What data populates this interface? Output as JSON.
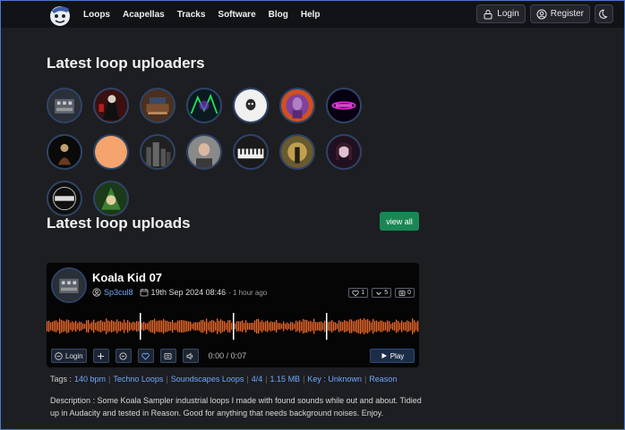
{
  "nav": {
    "links": [
      "Loops",
      "Acapellas",
      "Tracks",
      "Software",
      "Blog",
      "Help"
    ],
    "login": "Login",
    "register": "Register"
  },
  "sections": {
    "uploaders_title": "Latest loop uploaders",
    "uploads_title": "Latest loop uploads",
    "view_all": "view all"
  },
  "uploaders": [
    {
      "icon": "synth-avatar"
    },
    {
      "icon": "red-figure-avatar"
    },
    {
      "icon": "studio-avatar"
    },
    {
      "icon": "neon-avatar"
    },
    {
      "icon": "skull-avatar"
    },
    {
      "icon": "purple-portrait-avatar"
    },
    {
      "icon": "pink-logo-avatar"
    },
    {
      "icon": "dark-figure-avatar"
    },
    {
      "icon": "orange-avatar"
    },
    {
      "icon": "city-avatar"
    },
    {
      "icon": "man-portrait-avatar"
    },
    {
      "icon": "keyboard-avatar"
    },
    {
      "icon": "forest-figure-avatar"
    },
    {
      "icon": "girl-portrait-avatar"
    },
    {
      "icon": "radius-logo-avatar"
    },
    {
      "icon": "mask-avatar"
    }
  ],
  "loop": {
    "title": "Koala Kid 07",
    "user": "Sp3cul8",
    "date": "19th Sep 2024 08:46",
    "ago": "- 1 hour ago",
    "likes": "1",
    "downloads": "5",
    "comments": "0",
    "login_btn": "Login",
    "time": "0:00 / 0:07",
    "play": "Play",
    "tags_label": "Tags :",
    "tags": [
      "140 bpm",
      "Techno Loops",
      "Soundscapes Loops",
      "4/4",
      "1.15 MB",
      "Key : Unknown",
      "Reason"
    ],
    "description": "Description : Some Koala Sampler industrial loops I made with found sounds while out and about. Tidied up in Audacity and tested in Reason. Good for anything that needs background noises. Enjoy."
  },
  "colors": {
    "accent_green": "#198754",
    "link_blue": "#6ea8fe",
    "waveform": "#f36b2d",
    "background": "#1d1e22"
  }
}
